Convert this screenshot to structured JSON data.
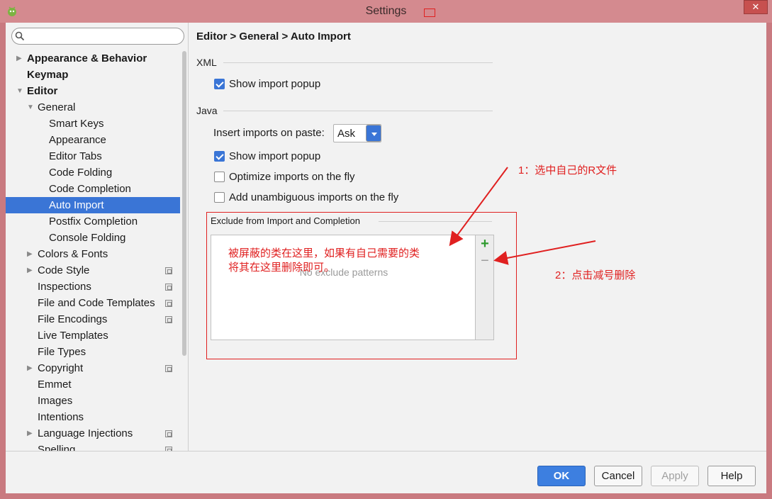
{
  "window": {
    "title": "Settings",
    "close_label": "✕"
  },
  "search": {
    "placeholder": "",
    "icon": "search-icon"
  },
  "sidebar": {
    "items": [
      {
        "label": "Appearance & Behavior",
        "level": 0,
        "arrow": "▶",
        "bold": true
      },
      {
        "label": "Keymap",
        "level": 0,
        "arrow": "",
        "bold": true
      },
      {
        "label": "Editor",
        "level": 0,
        "arrow": "▼",
        "bold": true
      },
      {
        "label": "General",
        "level": 1,
        "arrow": "▼"
      },
      {
        "label": "Smart Keys",
        "level": 2,
        "arrow": ""
      },
      {
        "label": "Appearance",
        "level": 2,
        "arrow": ""
      },
      {
        "label": "Editor Tabs",
        "level": 2,
        "arrow": ""
      },
      {
        "label": "Code Folding",
        "level": 2,
        "arrow": ""
      },
      {
        "label": "Code Completion",
        "level": 2,
        "arrow": ""
      },
      {
        "label": "Auto Import",
        "level": 2,
        "arrow": "",
        "selected": true
      },
      {
        "label": "Postfix Completion",
        "level": 2,
        "arrow": ""
      },
      {
        "label": "Console Folding",
        "level": 2,
        "arrow": ""
      },
      {
        "label": "Colors & Fonts",
        "level": 1,
        "arrow": "▶"
      },
      {
        "label": "Code Style",
        "level": 1,
        "arrow": "▶",
        "project": true
      },
      {
        "label": "Inspections",
        "level": 1,
        "arrow": "",
        "project": true
      },
      {
        "label": "File and Code Templates",
        "level": 1,
        "arrow": "",
        "project": true
      },
      {
        "label": "File Encodings",
        "level": 1,
        "arrow": "",
        "project": true
      },
      {
        "label": "Live Templates",
        "level": 1,
        "arrow": ""
      },
      {
        "label": "File Types",
        "level": 1,
        "arrow": ""
      },
      {
        "label": "Copyright",
        "level": 1,
        "arrow": "▶",
        "project": true
      },
      {
        "label": "Emmet",
        "level": 1,
        "arrow": ""
      },
      {
        "label": "Images",
        "level": 1,
        "arrow": ""
      },
      {
        "label": "Intentions",
        "level": 1,
        "arrow": ""
      },
      {
        "label": "Language Injections",
        "level": 1,
        "arrow": "▶",
        "project": true
      },
      {
        "label": "Spelling",
        "level": 1,
        "arrow": "",
        "project": true
      }
    ]
  },
  "breadcrumb": "Editor > General > Auto Import",
  "xml": {
    "section_label": "XML",
    "show_popup_label": "Show import popup",
    "show_popup_checked": true
  },
  "java": {
    "section_label": "Java",
    "paste_label": "Insert imports on paste:",
    "paste_value": "Ask",
    "show_popup_label": "Show import popup",
    "show_popup_checked": true,
    "optimize_label": "Optimize imports on the fly",
    "optimize_checked": false,
    "unambiguous_label": "Add unambiguous imports on the fly",
    "unambiguous_checked": false
  },
  "exclude": {
    "title": "Exclude from Import and Completion",
    "empty_text": "No exclude patterns",
    "add_label": "+",
    "remove_label": "−"
  },
  "annotations": {
    "step1": "1：选中自己的R文件",
    "step2": "2：点击减号删除",
    "note_line1": "被屏蔽的类在这里，如果有自己需要的类",
    "note_line2": "将其在这里删除即可。"
  },
  "footer": {
    "ok": "OK",
    "cancel": "Cancel",
    "apply": "Apply",
    "help": "Help"
  },
  "colors": {
    "selection": "#3a75d6",
    "annotation": "#e02020",
    "title_bar": "#d48a8f"
  }
}
